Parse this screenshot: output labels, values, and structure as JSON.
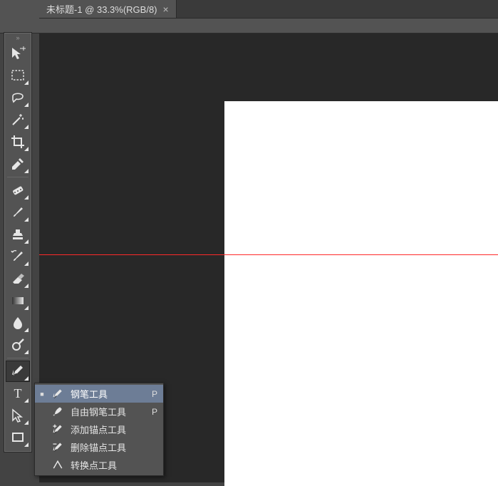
{
  "tab": {
    "title": "未标题-1 @ 33.3%(RGB/8)"
  },
  "tools": [
    {
      "id": "move",
      "icon": "move",
      "sub": false
    },
    {
      "id": "marquee",
      "icon": "marquee",
      "sub": true
    },
    {
      "id": "lasso",
      "icon": "lasso",
      "sub": true
    },
    {
      "id": "wand",
      "icon": "wand",
      "sub": true
    },
    {
      "id": "crop",
      "icon": "crop",
      "sub": true
    },
    {
      "id": "eyedropper",
      "icon": "eyedropper",
      "sub": true
    },
    {
      "id": "heal",
      "icon": "heal",
      "sub": true
    },
    {
      "id": "brush",
      "icon": "brush",
      "sub": true
    },
    {
      "id": "stamp",
      "icon": "stamp",
      "sub": true
    },
    {
      "id": "history",
      "icon": "history",
      "sub": true
    },
    {
      "id": "eraser",
      "icon": "eraser",
      "sub": true
    },
    {
      "id": "gradient",
      "icon": "gradient",
      "sub": true
    },
    {
      "id": "blur",
      "icon": "blur",
      "sub": true
    },
    {
      "id": "dodge",
      "icon": "dodge",
      "sub": true
    },
    {
      "id": "pen",
      "icon": "pen",
      "sub": true,
      "active": true
    },
    {
      "id": "type",
      "icon": "type",
      "sub": true
    },
    {
      "id": "path-sel",
      "icon": "path-sel",
      "sub": true
    },
    {
      "id": "shape",
      "icon": "shape",
      "sub": true
    }
  ],
  "flyout": {
    "items": [
      {
        "label": "钢笔工具",
        "shortcut": "P",
        "selected": true,
        "icon": "pen"
      },
      {
        "label": "自由钢笔工具",
        "shortcut": "P",
        "selected": false,
        "icon": "free-pen"
      },
      {
        "label": "添加锚点工具",
        "shortcut": "",
        "selected": false,
        "icon": "add-anchor"
      },
      {
        "label": "删除锚点工具",
        "shortcut": "",
        "selected": false,
        "icon": "del-anchor"
      },
      {
        "label": "转换点工具",
        "shortcut": "",
        "selected": false,
        "icon": "convert"
      }
    ]
  }
}
